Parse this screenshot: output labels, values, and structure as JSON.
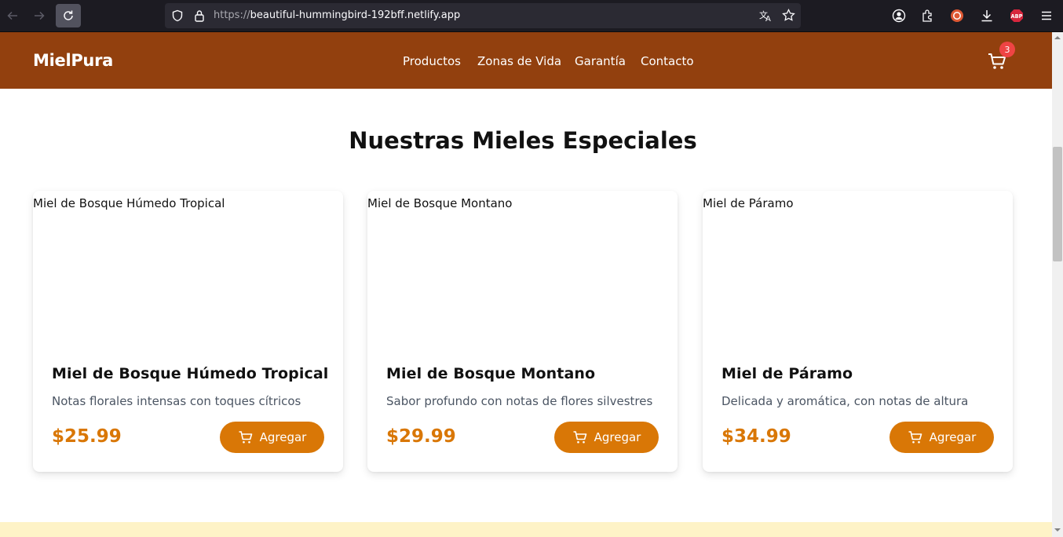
{
  "browser": {
    "url_protocol": "https://",
    "url_host": "beautiful-hummingbird-192bff.netlify.app",
    "icons": [
      "back-icon",
      "forward-icon",
      "reload-icon",
      "shield-icon",
      "lock-icon",
      "translate-icon",
      "star-icon",
      "account-icon",
      "extensions-icon",
      "duckduckgo-icon",
      "abp-icon",
      "download-icon",
      "menu-icon"
    ],
    "abp_label": "ABP"
  },
  "header": {
    "logo": "MielPura",
    "nav": [
      "Productos",
      "Zonas de Vida",
      "Garantía",
      "Contacto"
    ],
    "cart_count": "3",
    "bg_color": "#92400e"
  },
  "main": {
    "title": "Nuestras Mieles Especiales",
    "accent_color": "#d97706",
    "products": [
      {
        "image_alt": "Miel de Bosque Húmedo Tropical",
        "name": "Miel de Bosque Húmedo Tropical",
        "description": "Notas florales intensas con toques cítricos",
        "price": "$25.99",
        "button": "Agregar"
      },
      {
        "image_alt": "Miel de Bosque Montano",
        "name": "Miel de Bosque Montano",
        "description": "Sabor profundo con notas de flores silvestres",
        "price": "$29.99",
        "button": "Agregar"
      },
      {
        "image_alt": "Miel de Páramo",
        "name": "Miel de Páramo",
        "description": "Delicada y aromática, con notas de altura",
        "price": "$34.99",
        "button": "Agregar"
      }
    ]
  }
}
